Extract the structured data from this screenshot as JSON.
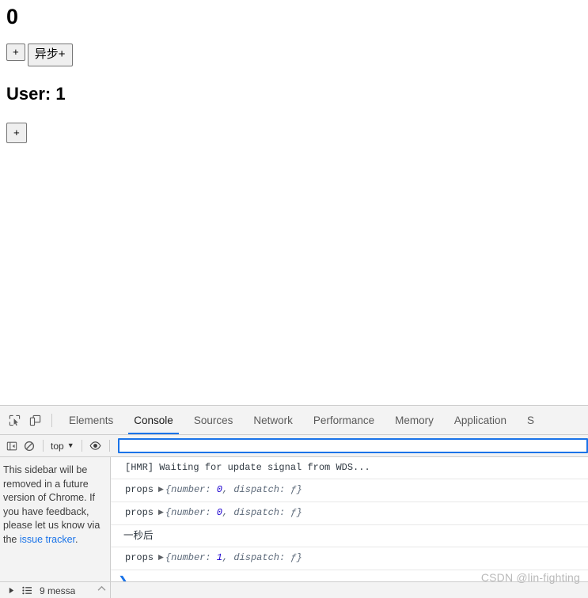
{
  "page": {
    "count_heading": "0",
    "user_heading": "User: 1",
    "buttons": [
      {
        "name": "increment-button",
        "label": "+"
      },
      {
        "name": "async-increment-button",
        "label": "异步+"
      },
      {
        "name": "user-increment-button",
        "label": "+"
      }
    ]
  },
  "devtools": {
    "icons": {
      "inspect": "inspect-element-icon",
      "device": "device-toolbar-icon",
      "sidebar_toggle": "console-sidebar-toggle-icon",
      "clear": "clear-console-icon",
      "eye": "live-expression-eye-icon",
      "settings": "settings-gear-icon"
    },
    "tabs": [
      {
        "label": "Elements",
        "active": false
      },
      {
        "label": "Console",
        "active": true
      },
      {
        "label": "Sources",
        "active": false
      },
      {
        "label": "Network",
        "active": false
      },
      {
        "label": "Performance",
        "active": false
      },
      {
        "label": "Memory",
        "active": false
      },
      {
        "label": "Application",
        "active": false
      },
      {
        "label": "S",
        "active": false
      }
    ],
    "filterbar": {
      "context_label": "top",
      "caret": "▼",
      "filter_value": "",
      "filter_placeholder": ""
    },
    "sidebar": {
      "note_text": "This sidebar will be removed in a future version of Chrome. If you have feedback, please let us know via the ",
      "note_link": "issue tracker",
      "note_tail": "."
    },
    "console": {
      "rows": [
        {
          "type": "plain",
          "text": "[HMR] Waiting for update signal from WDS..."
        },
        {
          "type": "object",
          "label": "props",
          "triangle": "▶",
          "open": "{",
          "key1": "number: ",
          "val1": "0",
          "sep": ", ",
          "key2": "dispatch: ",
          "val2": "ƒ",
          "close": "}"
        },
        {
          "type": "object",
          "label": "props",
          "triangle": "▶",
          "open": "{",
          "key1": "number: ",
          "val1": "0",
          "sep": ", ",
          "key2": "dispatch: ",
          "val2": "ƒ",
          "close": "}"
        },
        {
          "type": "cjk",
          "text": "一秒后"
        },
        {
          "type": "object",
          "label": "props",
          "triangle": "▶",
          "open": "{",
          "key1": "number: ",
          "val1": "1",
          "sep": ", ",
          "key2": "dispatch: ",
          "val2": "ƒ",
          "close": "}"
        }
      ],
      "prompt_chevron": "❯"
    },
    "statusbar": {
      "expand_arrow": "▶",
      "list_icon": "message-list-icon",
      "message_count_text": "9 messa",
      "collapse_arrow": "▲"
    }
  },
  "watermark": {
    "text": "CSDN @lin-fighting"
  },
  "colors": {
    "accent": "#1a73e8",
    "chrome_bg": "#f3f3f3",
    "border": "#cdcdcd",
    "console_text": "#303942",
    "object_preview": "#5b6878",
    "number_literal": "#1c00cf",
    "link": "#1a73e8",
    "watermark": "#b9b9b9"
  }
}
